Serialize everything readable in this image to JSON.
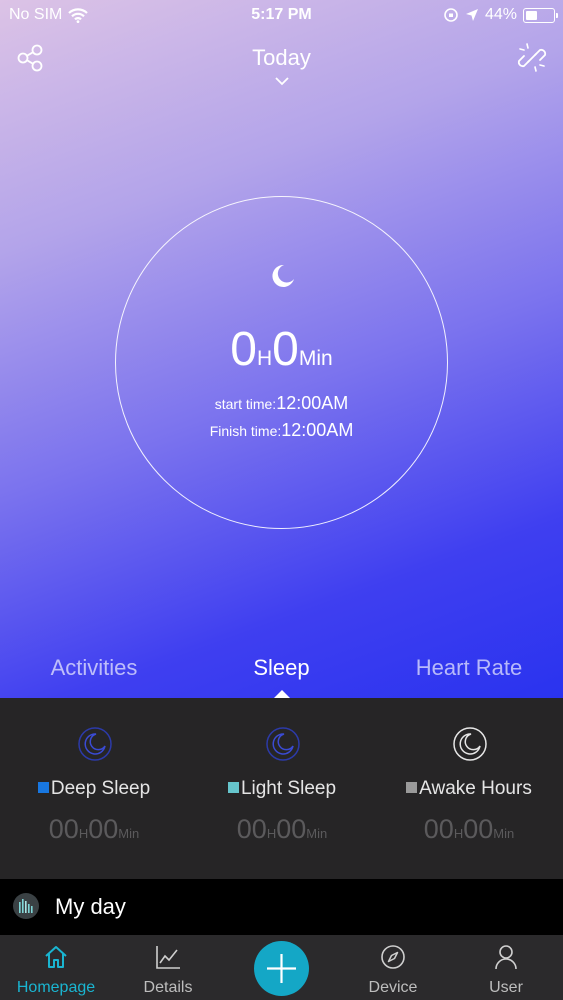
{
  "status_bar": {
    "carrier": "No SIM",
    "time": "5:17 PM",
    "battery": "44%",
    "battery_level": 0.44
  },
  "header": {
    "title": "Today"
  },
  "sleep_summary": {
    "hours": "0",
    "hours_unit": "H",
    "minutes": "0",
    "minutes_unit": "Min",
    "start_label": "start time:",
    "start_value": "12:00AM",
    "finish_label": "Finish time:",
    "finish_value": "12:00AM"
  },
  "tabs": [
    {
      "label": "Activities",
      "active": false
    },
    {
      "label": "Sleep",
      "active": true
    },
    {
      "label": "Heart Rate",
      "active": false
    }
  ],
  "stats": [
    {
      "label": "Deep Sleep",
      "color": "#1877e0",
      "icon": "moon-icon",
      "h": "00",
      "h_unit": "H",
      "m": "00",
      "m_unit": "Min"
    },
    {
      "label": "Light Sleep",
      "color": "#66c5cc",
      "icon": "moon-icon",
      "h": "00",
      "h_unit": "H",
      "m": "00",
      "m_unit": "Min"
    },
    {
      "label": "Awake Hours",
      "color": "#9a9a9a",
      "icon": "moon-icon",
      "h": "00",
      "h_unit": "H",
      "m": "00",
      "m_unit": "Min"
    }
  ],
  "my_day": {
    "label": "My day",
    "icon": "chart-bars-icon"
  },
  "nav": [
    {
      "label": "Homepage",
      "icon": "home-icon",
      "active": true
    },
    {
      "label": "Details",
      "icon": "line-chart-icon",
      "active": false
    },
    {
      "label": "",
      "icon": "plus-icon",
      "active": false
    },
    {
      "label": "Device",
      "icon": "compass-icon",
      "active": false
    },
    {
      "label": "User",
      "icon": "user-icon",
      "active": false
    }
  ],
  "colors": {
    "accent": "#14a7c6",
    "panel": "#262526",
    "nav_bg": "#2b2a2c"
  }
}
